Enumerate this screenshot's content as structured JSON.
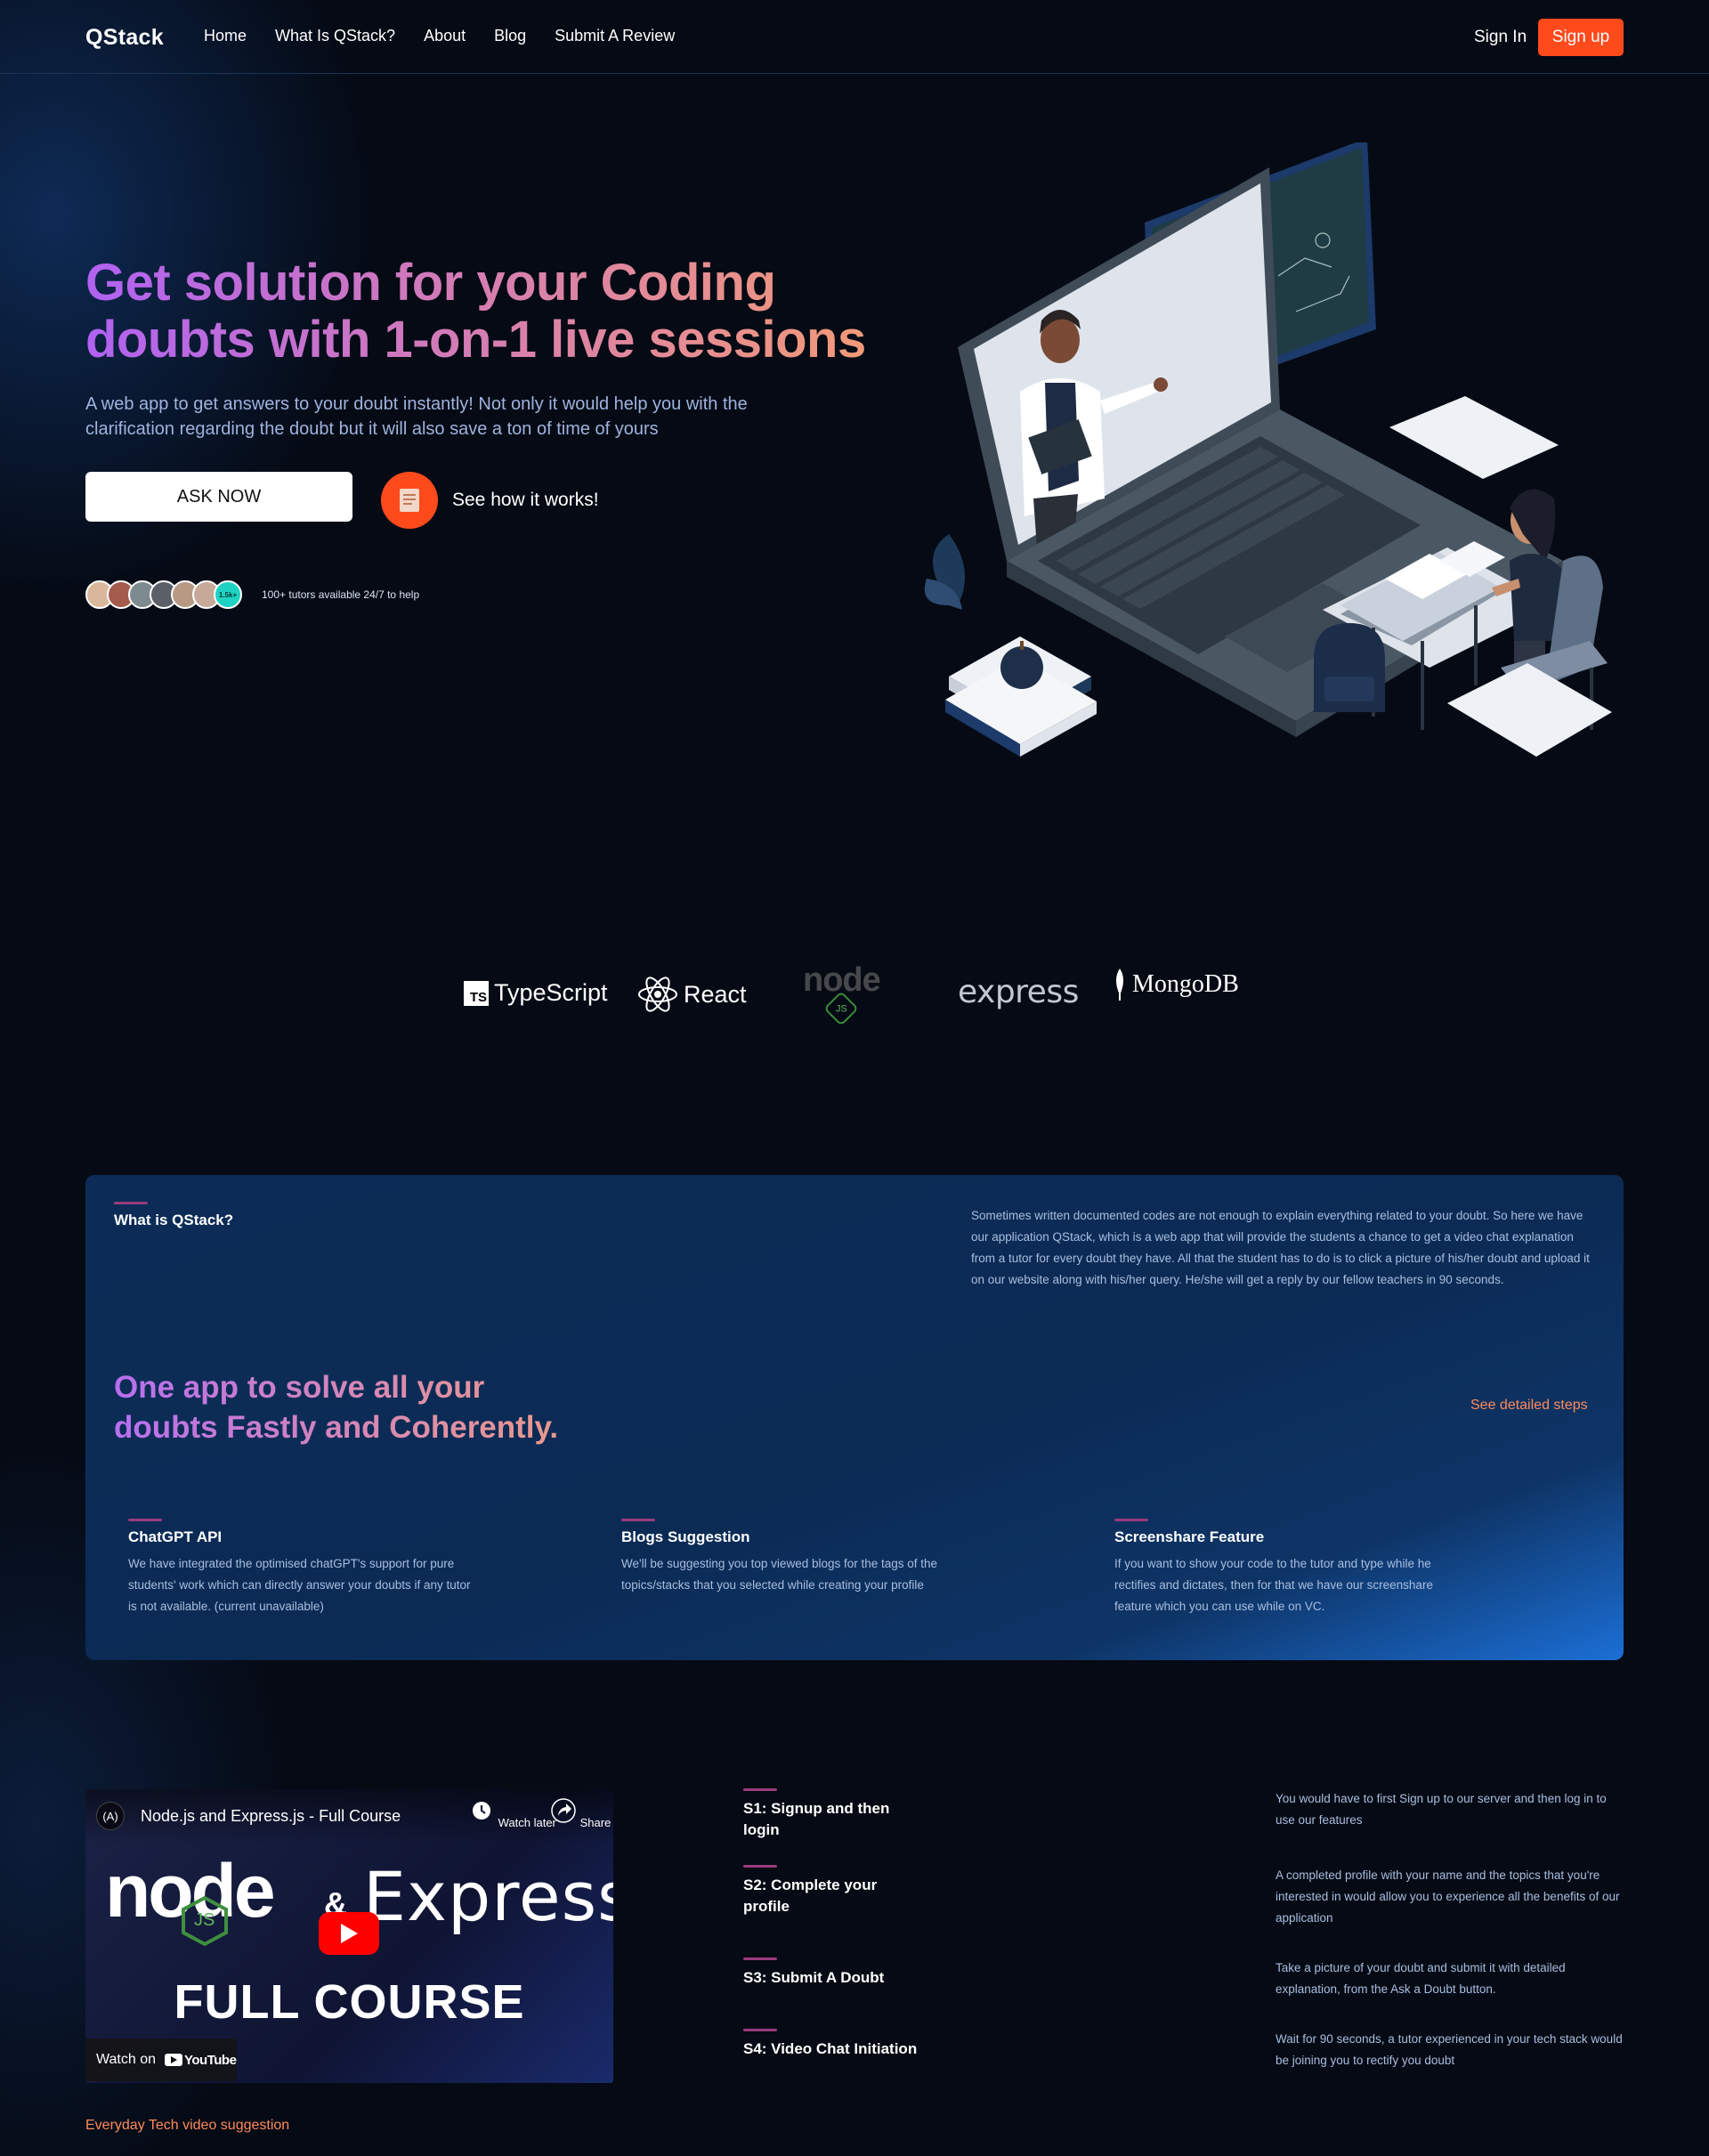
{
  "nav": {
    "logo": "QStack",
    "links": [
      "Home",
      "What Is QStack?",
      "About",
      "Blog",
      "Submit A Review"
    ],
    "sign_in": "Sign In",
    "sign_up": "Sign up"
  },
  "hero": {
    "title_line1": "Get solution for your Coding",
    "title_line2": "doubts with 1-on-1 live sessions",
    "subtitle": "A web app to get answers to your doubt instantly! Not only it would help you with the clarification regarding the doubt but it will also save a ton of time of yours",
    "ask_button": "ASK NOW",
    "how_button": "See how it works!",
    "tutor_count_badge": "1.5k+",
    "tutors_text": "100+ tutors available 24/7 to help"
  },
  "tech": {
    "typescript": "TypeScript",
    "react": "React",
    "node": "node",
    "node_js": "JS",
    "express": "express",
    "mongodb": "MongoDB"
  },
  "about": {
    "eyebrow": "What is QStack?",
    "description": "Sometimes written documented codes are not enough to explain everything related to your doubt. So here we have our application QStack, which is a web app that will provide the students a chance to get a video chat explanation from a tutor for every doubt they have. All that the student has to do is to click a picture of his/her doubt and upload it on our website along with his/her query. He/she will get a reply by our fellow teachers in 90 seconds.",
    "heading_line1": "One app to solve all your",
    "heading_line2": "doubts Fastly and Coherently.",
    "steps_link": "See detailed steps",
    "features": [
      {
        "title": "ChatGPT API",
        "description": "We have integrated the optimised chatGPT's support for pure students' work which can directly answer your doubts if any tutor is not available. (current unavailable)"
      },
      {
        "title": "Blogs Suggestion",
        "description": "We'll be suggesting you top viewed blogs for the tags of the topics/stacks that you selected while creating your profile"
      },
      {
        "title": "Screenshare Feature",
        "description": "If you want to show your code to the tutor and type while he rectifies and dictates, then for that we have our screenshare feature which you can use while on VC."
      }
    ]
  },
  "video": {
    "channel_badge": "(A)",
    "title": "Node.js and Express.js - Full Course",
    "watch_later": "Watch later",
    "share": "Share",
    "thumb_node": "node",
    "thumb_js": "JS",
    "thumb_amp": "&",
    "thumb_express": "Express",
    "thumb_full": "FULL COURSE",
    "watch_on": "Watch on",
    "youtube": "YouTube",
    "caption": "Everyday Tech video suggestion"
  },
  "steps": [
    {
      "title": "S1: Signup and then login",
      "description": "You would have to first Sign up to our server and then log in to use our features"
    },
    {
      "title": "S2: Complete your profile",
      "description": "A completed profile with your name and the topics that you're interested in would allow you to experience all the benefits of our application"
    },
    {
      "title": "S3: Submit A Doubt",
      "description": "Take a picture of your doubt and submit it with detailed explanation, from the Ask a Doubt button."
    },
    {
      "title": "S4: Video Chat Initiation",
      "description": "Wait for 90 seconds, a tutor experienced in your tech stack would be joining you to rectify you doubt"
    }
  ],
  "colors": {
    "accent_orange": "#ff4a1c",
    "background": "#050a14",
    "card_blue": "#0b2b55",
    "gradient_purple": "#b062f2",
    "gradient_peach": "#f39a78"
  }
}
